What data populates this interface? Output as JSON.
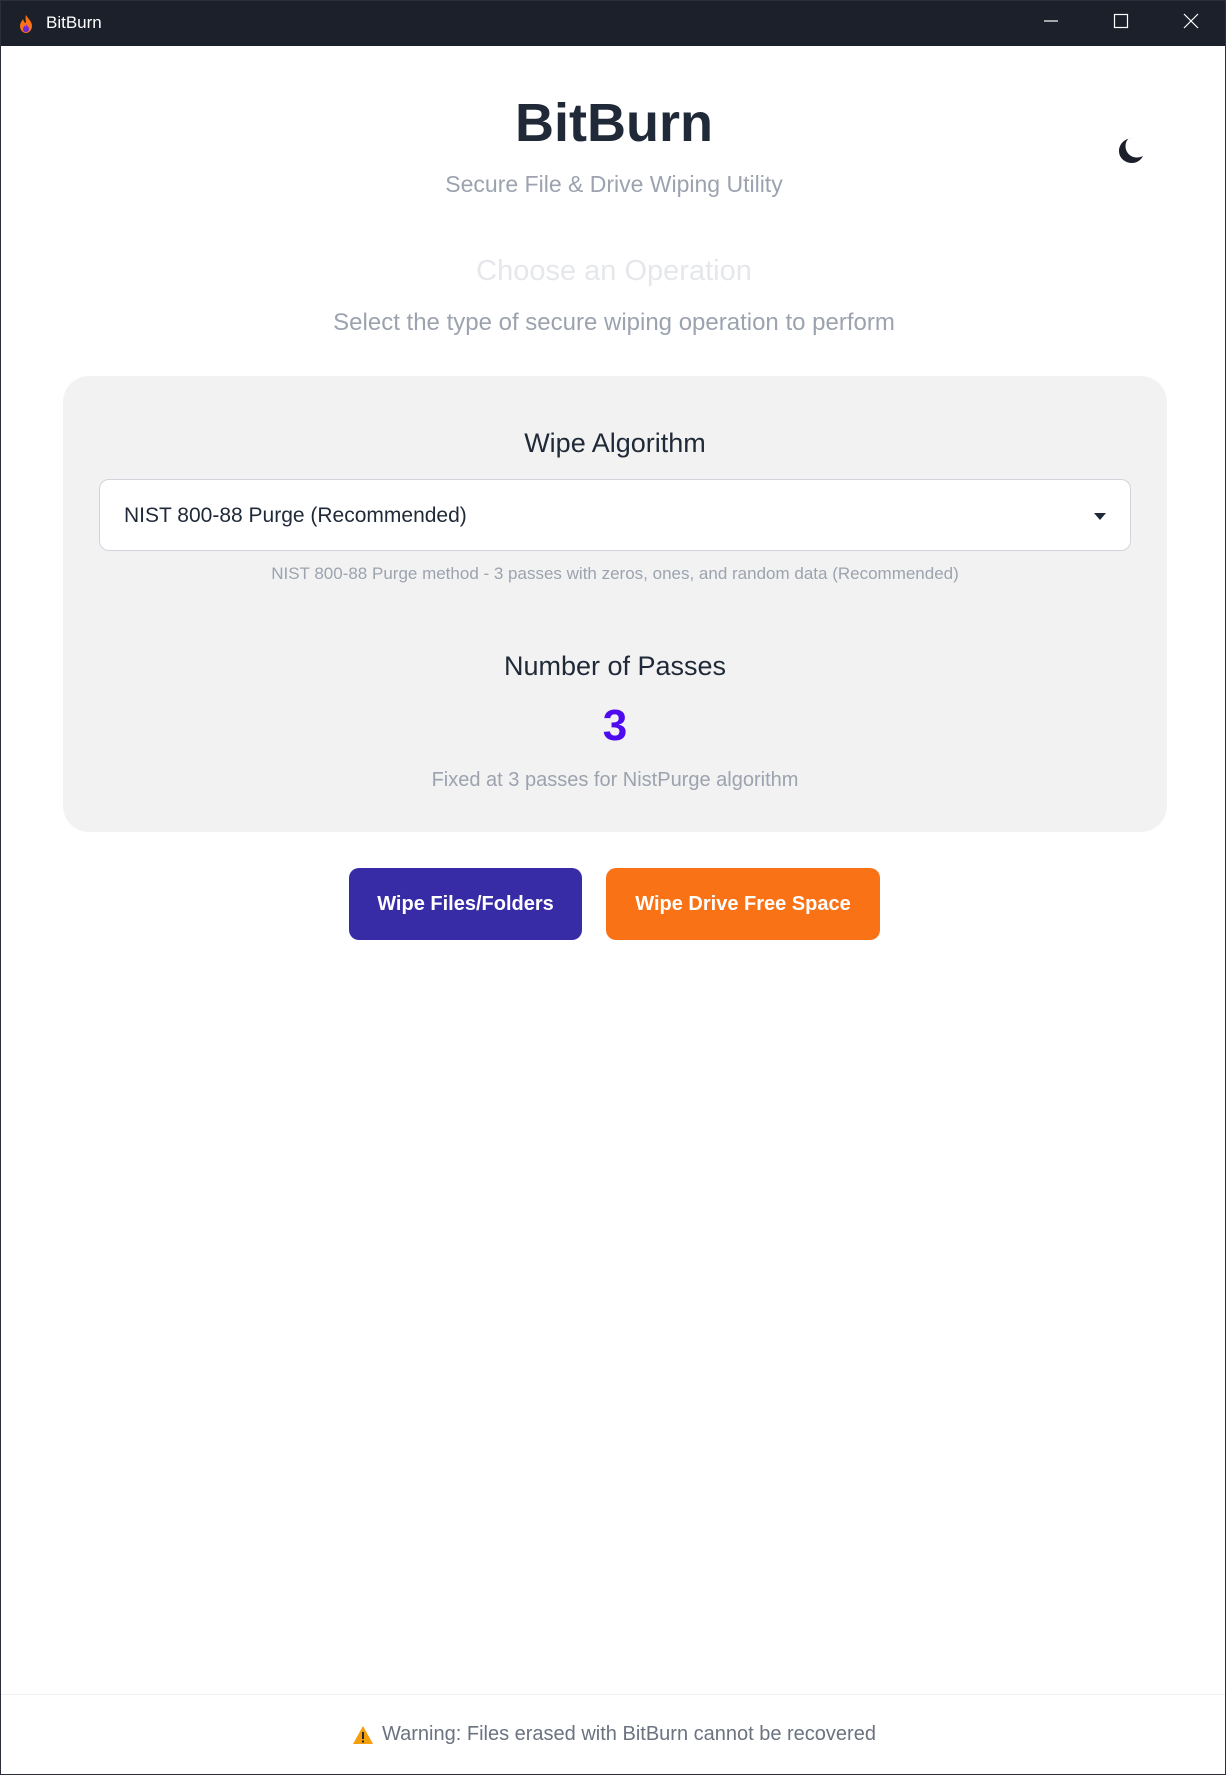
{
  "window": {
    "title": "BitBurn",
    "icons": {
      "app": "flame-icon",
      "minimize": "minimize-icon",
      "maximize": "maximize-icon",
      "close": "close-icon"
    }
  },
  "header": {
    "title": "BitBurn",
    "subtitle": "Secure File & Drive Wiping Utility",
    "theme_toggle_icon": "moon-icon"
  },
  "operation": {
    "heading": "Choose an Operation",
    "subheading": "Select the type of secure wiping operation to perform"
  },
  "settings": {
    "algorithm_label": "Wipe Algorithm",
    "algorithm_selected": "NIST 800-88 Purge (Recommended)",
    "algorithm_description": "NIST 800-88 Purge method - 3 passes with zeros, ones, and random data (Recommended)",
    "passes_label": "Number of Passes",
    "passes_value": "3",
    "passes_note": "Fixed at 3 passes for NistPurge algorithm"
  },
  "actions": {
    "wipe_files": "Wipe Files/Folders",
    "wipe_drive": "Wipe Drive Free Space"
  },
  "footer": {
    "warning_icon": "warning-icon",
    "warning": "Warning: Files erased with BitBurn cannot be recovered"
  },
  "colors": {
    "titlebar": "#1b202b",
    "passes_accent": "#4f0bf0",
    "wipe_files_button": "#372ca5",
    "wipe_drive_button": "#f97316",
    "card_background": "#f2f2f2"
  }
}
